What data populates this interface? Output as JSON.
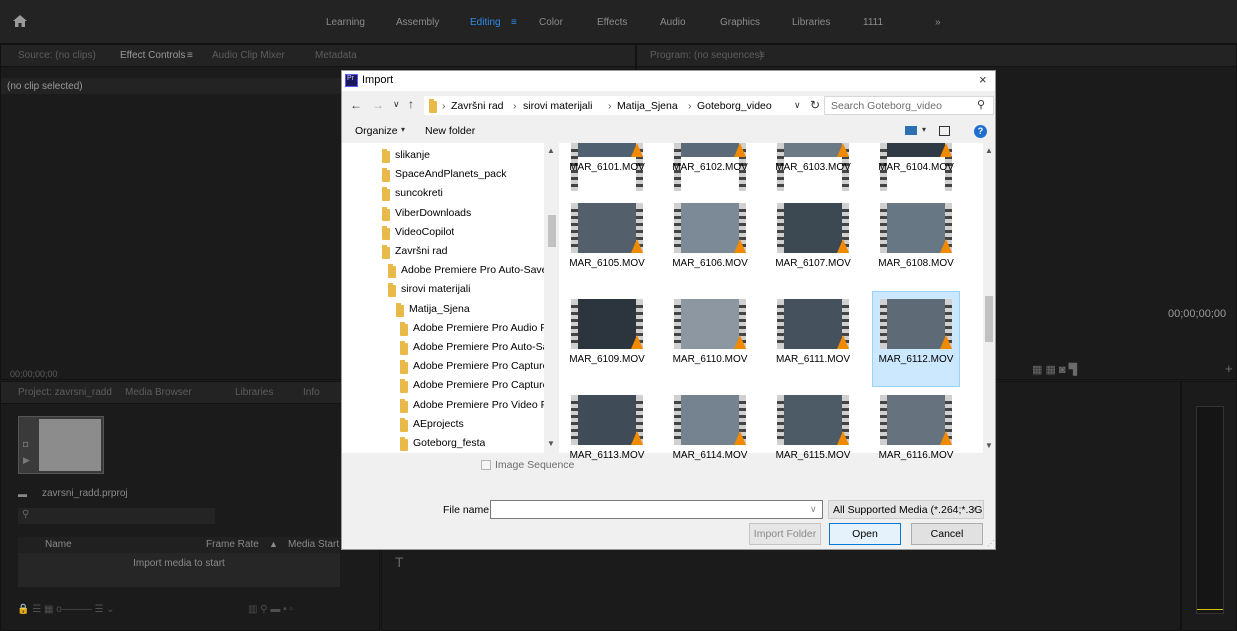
{
  "workspaces": {
    "items": [
      "Learning",
      "Assembly",
      "Editing",
      "Color",
      "Effects",
      "Audio",
      "Graphics",
      "Libraries",
      "1111"
    ],
    "active": "Editing",
    "overflow": "»"
  },
  "source_panel": {
    "tabs": [
      "Source: (no clips)",
      "Effect Controls",
      "Audio Clip Mixer",
      "Metadata"
    ],
    "no_clip": "(no clip selected)",
    "timecode": "00;00;00;00"
  },
  "program_panel": {
    "tab": "Program: (no sequences)",
    "timecode": "00;00;00;00"
  },
  "project_panel": {
    "tabs": [
      "Project: zavrsni_radd",
      "Media Browser",
      "Libraries",
      "Info"
    ],
    "project_file": "zavrsni_radd.prproj",
    "columns": [
      "Name",
      "Frame Rate",
      "Media Start"
    ],
    "empty": "Import media to start"
  },
  "dialog": {
    "title": "Import",
    "path": [
      "Završni rad",
      "sirovi materijali",
      "Matija_Sjena",
      "Goteborg_video"
    ],
    "search_placeholder": "Search Goteborg_video",
    "organize": "Organize",
    "new_folder": "New folder",
    "nav_items": [
      {
        "label": "slikanje",
        "level": 0
      },
      {
        "label": "SpaceAndPlanets_pack",
        "level": 0
      },
      {
        "label": "suncokreti",
        "level": 0
      },
      {
        "label": "ViberDownloads",
        "level": 0
      },
      {
        "label": "VideoCopilot",
        "level": 0
      },
      {
        "label": "Završni rad",
        "level": 0
      },
      {
        "label": "Adobe Premiere Pro Auto-Save",
        "level": 1
      },
      {
        "label": "sirovi materijali",
        "level": 1
      },
      {
        "label": "Matija_Sjena",
        "level": 2
      },
      {
        "label": "Adobe Premiere Pro Audio Pre",
        "level": 3
      },
      {
        "label": "Adobe Premiere Pro Auto-Save",
        "level": 3
      },
      {
        "label": "Adobe Premiere Pro Captured",
        "level": 3
      },
      {
        "label": "Adobe Premiere Pro Captured",
        "level": 3
      },
      {
        "label": "Adobe Premiere Pro Video Pre",
        "level": 3
      },
      {
        "label": "AEprojects",
        "level": 3
      },
      {
        "label": "Goteborg_festa",
        "level": 3
      }
    ],
    "files": [
      "MAR_6101.MOV",
      "MAR_6102.MOV",
      "MAR_6103.MOV",
      "MAR_6104.MOV",
      "MAR_6105.MOV",
      "MAR_6106.MOV",
      "MAR_6107.MOV",
      "MAR_6108.MOV",
      "MAR_6109.MOV",
      "MAR_6110.MOV",
      "MAR_6111.MOV",
      "MAR_6112.MOV",
      "MAR_6113.MOV",
      "MAR_6114.MOV",
      "MAR_6115.MOV",
      "MAR_6116.MOV"
    ],
    "selected_file": "MAR_6112.MOV",
    "image_sequence": "Image Sequence",
    "file_name_label": "File name:",
    "file_name_value": "",
    "file_type": "All Supported Media (*.264;*.3G",
    "import_folder": "Import Folder",
    "open": "Open",
    "cancel": "Cancel"
  },
  "colors": {
    "accent": "#2d8ceb",
    "selection": "#cce8ff",
    "folder": "#e9b949"
  }
}
